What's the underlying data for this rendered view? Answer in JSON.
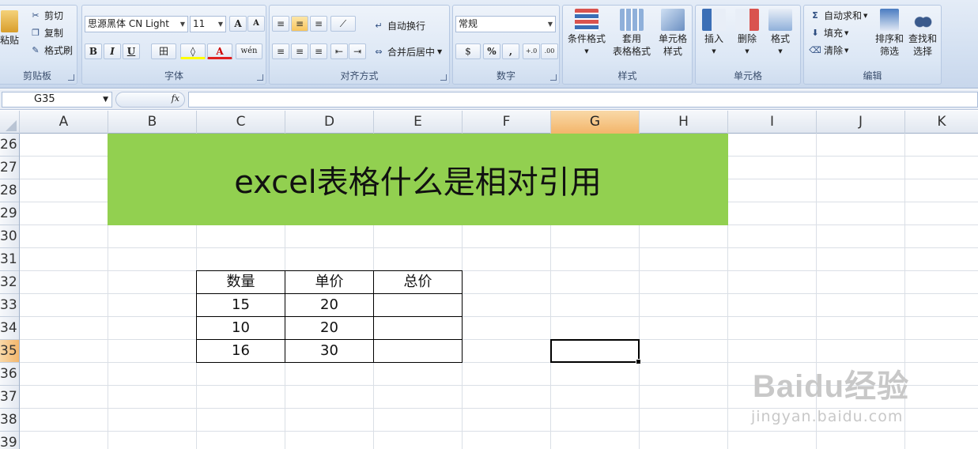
{
  "ribbon": {
    "clipboard": {
      "paste": "粘贴",
      "cut": "剪切",
      "copy": "复制",
      "format_painter": "格式刷",
      "label": "剪贴板"
    },
    "font": {
      "name": "思源黑体 CN Light",
      "size": "11",
      "grow": "A",
      "shrink": "A",
      "bold": "B",
      "italic": "I",
      "underline": "U",
      "border": "田",
      "fill": "◊",
      "font_color": "A",
      "phonetic": "wén",
      "label": "字体"
    },
    "alignment": {
      "wrap_text": "自动换行",
      "merge_center": "合并后居中",
      "label": "对齐方式"
    },
    "number": {
      "format": "常规",
      "currency": "$",
      "percent": "%",
      "comma": ",",
      "inc_decimal": "+.0",
      "dec_decimal": ".00",
      "label": "数字"
    },
    "styles": {
      "conditional": "条件格式",
      "table_format_1": "套用",
      "table_format_2": "表格格式",
      "cell_style_1": "单元格",
      "cell_style_2": "样式",
      "label": "样式"
    },
    "cells": {
      "insert": "插入",
      "delete": "删除",
      "format": "格式",
      "label": "单元格"
    },
    "editing": {
      "autosum": "自动求和",
      "fill": "填充",
      "clear": "清除",
      "sort_1": "排序和",
      "sort_2": "筛选",
      "find_1": "查找和",
      "find_2": "选择",
      "label": "编辑"
    }
  },
  "formula_bar": {
    "name_box": "G35",
    "fx": "fx",
    "value": ""
  },
  "columns": [
    "A",
    "B",
    "C",
    "D",
    "E",
    "F",
    "G",
    "H",
    "I",
    "J",
    "K"
  ],
  "selected_column": "G",
  "rows": [
    "26",
    "27",
    "28",
    "29",
    "30",
    "31",
    "32",
    "33",
    "34",
    "35",
    "36",
    "37",
    "38",
    "39"
  ],
  "selected_row": "35",
  "sheet": {
    "title": "excel表格什么是相对引用",
    "title_fill": "#92d050",
    "table": {
      "headers": [
        "数量",
        "单价",
        "总价"
      ],
      "rows": [
        [
          "15",
          "20",
          ""
        ],
        [
          "10",
          "20",
          ""
        ],
        [
          "16",
          "30",
          ""
        ]
      ]
    }
  },
  "watermark": {
    "logo": "Baidu经验",
    "url": "jingyan.baidu.com"
  }
}
